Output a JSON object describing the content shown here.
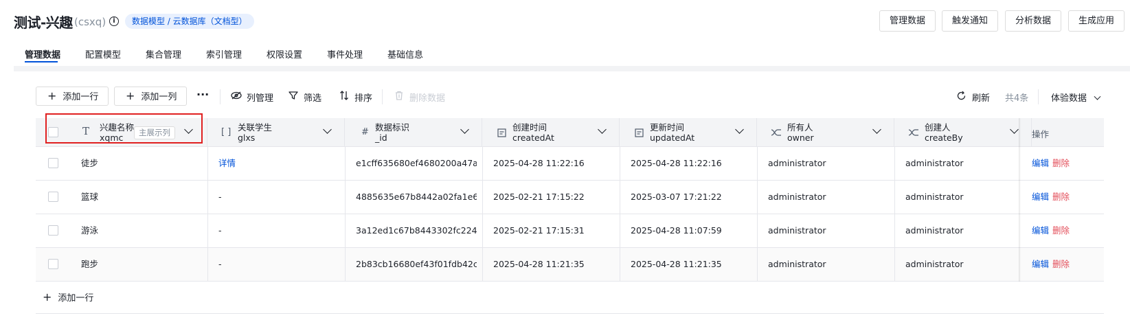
{
  "header": {
    "title": "测试-兴趣",
    "title_sub": "(csxq)",
    "breadcrumb": "数据模型 / 云数据库（文档型）",
    "buttons": [
      "管理数据",
      "触发通知",
      "分析数据",
      "生成应用"
    ]
  },
  "tabs": [
    "管理数据",
    "配置模型",
    "集合管理",
    "索引管理",
    "权限设置",
    "事件处理",
    "基础信息"
  ],
  "toolbar": {
    "add_row": "添加一行",
    "add_col": "添加一列",
    "more": "···",
    "column_manage": "列管理",
    "filter": "筛选",
    "sort": "排序",
    "delete_data": "删除数据",
    "refresh": "刷新",
    "total": "共4条",
    "env": "体验数据"
  },
  "columns": [
    {
      "icon": "text-type-icon",
      "name": "兴趣名称",
      "key": "xqmc",
      "tag": "主展示列"
    },
    {
      "icon": "relation-icon",
      "name": "关联学生",
      "key": "glxs"
    },
    {
      "icon": "hash-icon",
      "name": "数据标识",
      "key": "_id"
    },
    {
      "icon": "datetime-icon",
      "name": "创建时间",
      "key": "createdAt"
    },
    {
      "icon": "datetime-icon",
      "name": "更新时间",
      "key": "updatedAt"
    },
    {
      "icon": "user-icon",
      "name": "所有人",
      "key": "owner"
    },
    {
      "icon": "user-icon",
      "name": "创建人",
      "key": "createBy"
    },
    {
      "name": "操作"
    }
  ],
  "rows": [
    {
      "xqmc": "徒步",
      "glxs": "详情",
      "id": "e1cff635680ef4680200a47a...",
      "createdAt": "2025-04-28 11:22:16",
      "updatedAt": "2025-04-28 11:22:16",
      "owner": "administrator",
      "createBy": "administrator"
    },
    {
      "xqmc": "篮球",
      "glxs": "-",
      "id": "4885635e67b8442a02fa1e6...",
      "createdAt": "2025-02-21 17:15:22",
      "updatedAt": "2025-03-07 17:21:22",
      "owner": "administrator",
      "createBy": "administrator"
    },
    {
      "xqmc": "游泳",
      "glxs": "-",
      "id": "3a12ed1c67b8443302fc224...",
      "createdAt": "2025-02-21 17:15:31",
      "updatedAt": "2025-04-28 11:07:59",
      "owner": "administrator",
      "createBy": "administrator"
    },
    {
      "xqmc": "跑步",
      "glxs": "-",
      "id": "2b83cb16680ef43f01fdb42c...",
      "createdAt": "2025-04-28 11:21:35",
      "updatedAt": "2025-04-28 11:21:35",
      "owner": "administrator",
      "createBy": "administrator"
    }
  ],
  "row_actions": {
    "edit": "编辑",
    "delete": "删除"
  },
  "footer": {
    "add_row": "添加一行"
  },
  "colors": {
    "accent": "#0052d9",
    "danger": "#e34d59",
    "highlight": "#e02020"
  }
}
